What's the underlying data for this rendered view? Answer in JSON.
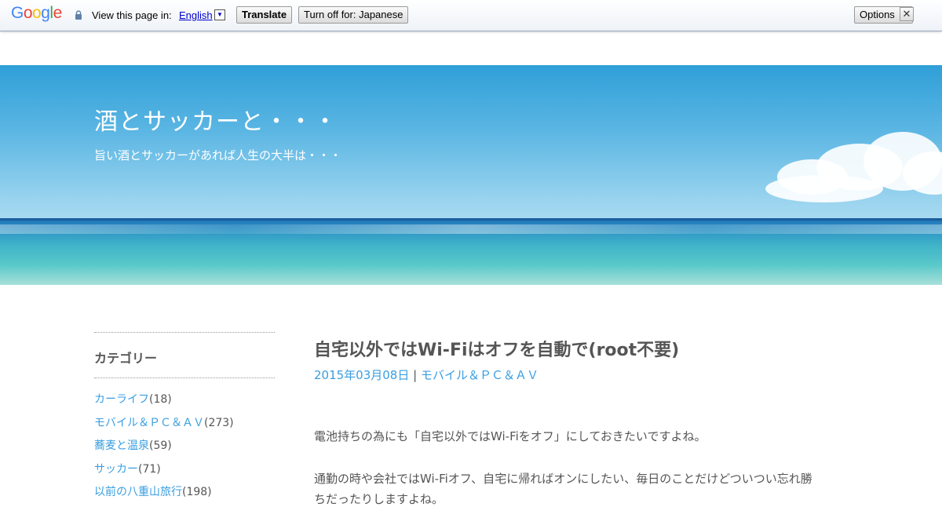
{
  "translate_bar": {
    "logo": "Google",
    "view_label": "View this page in:",
    "language": "English",
    "dropdown_glyph": "▼",
    "translate_button": "Translate",
    "turn_off_button": "Turn off for: Japanese",
    "options_button": "Options ▼",
    "close_glyph": "✕",
    "icons": [
      "lock-icon",
      "dropdown-icon",
      "close-icon"
    ]
  },
  "header": {
    "title": "酒とサッカーと・・・",
    "description": "旨い酒とサッカーがあれば人生の大半は・・・"
  },
  "sidebar": {
    "heading": "カテゴリー",
    "categories": [
      {
        "name": "カーライフ",
        "count": "(18)"
      },
      {
        "name": "モバイル＆ＰＣ＆ＡＶ",
        "count": "(273)"
      },
      {
        "name": "蕎麦と温泉",
        "count": "(59)"
      },
      {
        "name": "サッカー",
        "count": "(71)"
      },
      {
        "name": "以前の八重山旅行",
        "count": "(198)"
      }
    ]
  },
  "article": {
    "title": "自宅以外ではWi-Fiはオフを自動で(root不要)",
    "date": "2015年03月08日",
    "separator": "|",
    "category": "モバイル＆ＰＣ＆ＡＶ",
    "paragraph1": "電池持ちの為にも「自宅以外ではWi-Fiをオフ」にしておきたいですよね。",
    "paragraph2": "通勤の時や会社ではWi-Fiオフ、自宅に帰ればオンにしたい、毎日のことだけどついつい忘れ勝",
    "paragraph3": "ちだったりしますよね。"
  },
  "colors": {
    "link": "#3a9ee0",
    "text": "#555555",
    "google_blue": "#4285f4",
    "google_red": "#ea4335",
    "google_yellow": "#fbbc05",
    "google_green": "#34a853"
  }
}
